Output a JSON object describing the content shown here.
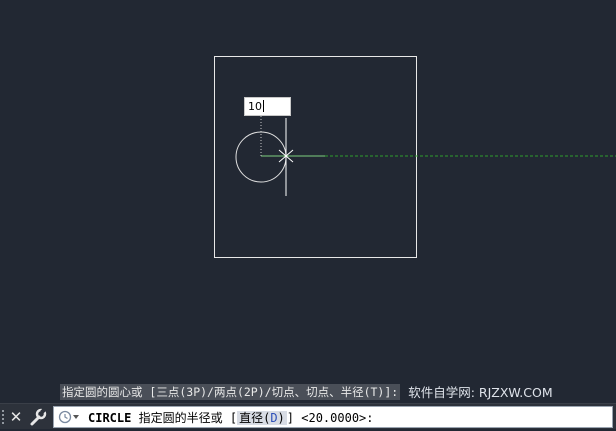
{
  "drawing": {
    "dynamic_input_value": "10"
  },
  "command_history": {
    "text": "指定圆的圆心或 [三点(3P)/两点(2P)/切点、切点、半径(T)]:"
  },
  "watermark": "软件自学网: RJZXW.COM",
  "command_line": {
    "command": "CIRCLE",
    "prompt": "指定圆的半径或",
    "bracket_open": "[",
    "option_label": "直径(",
    "option_key": "D",
    "option_close": ")",
    "bracket_close": "]",
    "default_value": "<20.0000>:"
  },
  "icons": {
    "close": "close-icon",
    "customize": "wrench-icon",
    "recent": "recent-commands-icon"
  },
  "colors": {
    "canvas": "#222833",
    "geometry": "#ffffff",
    "tracking_line": "#2e9e2e",
    "cursor": "#ffffff"
  }
}
